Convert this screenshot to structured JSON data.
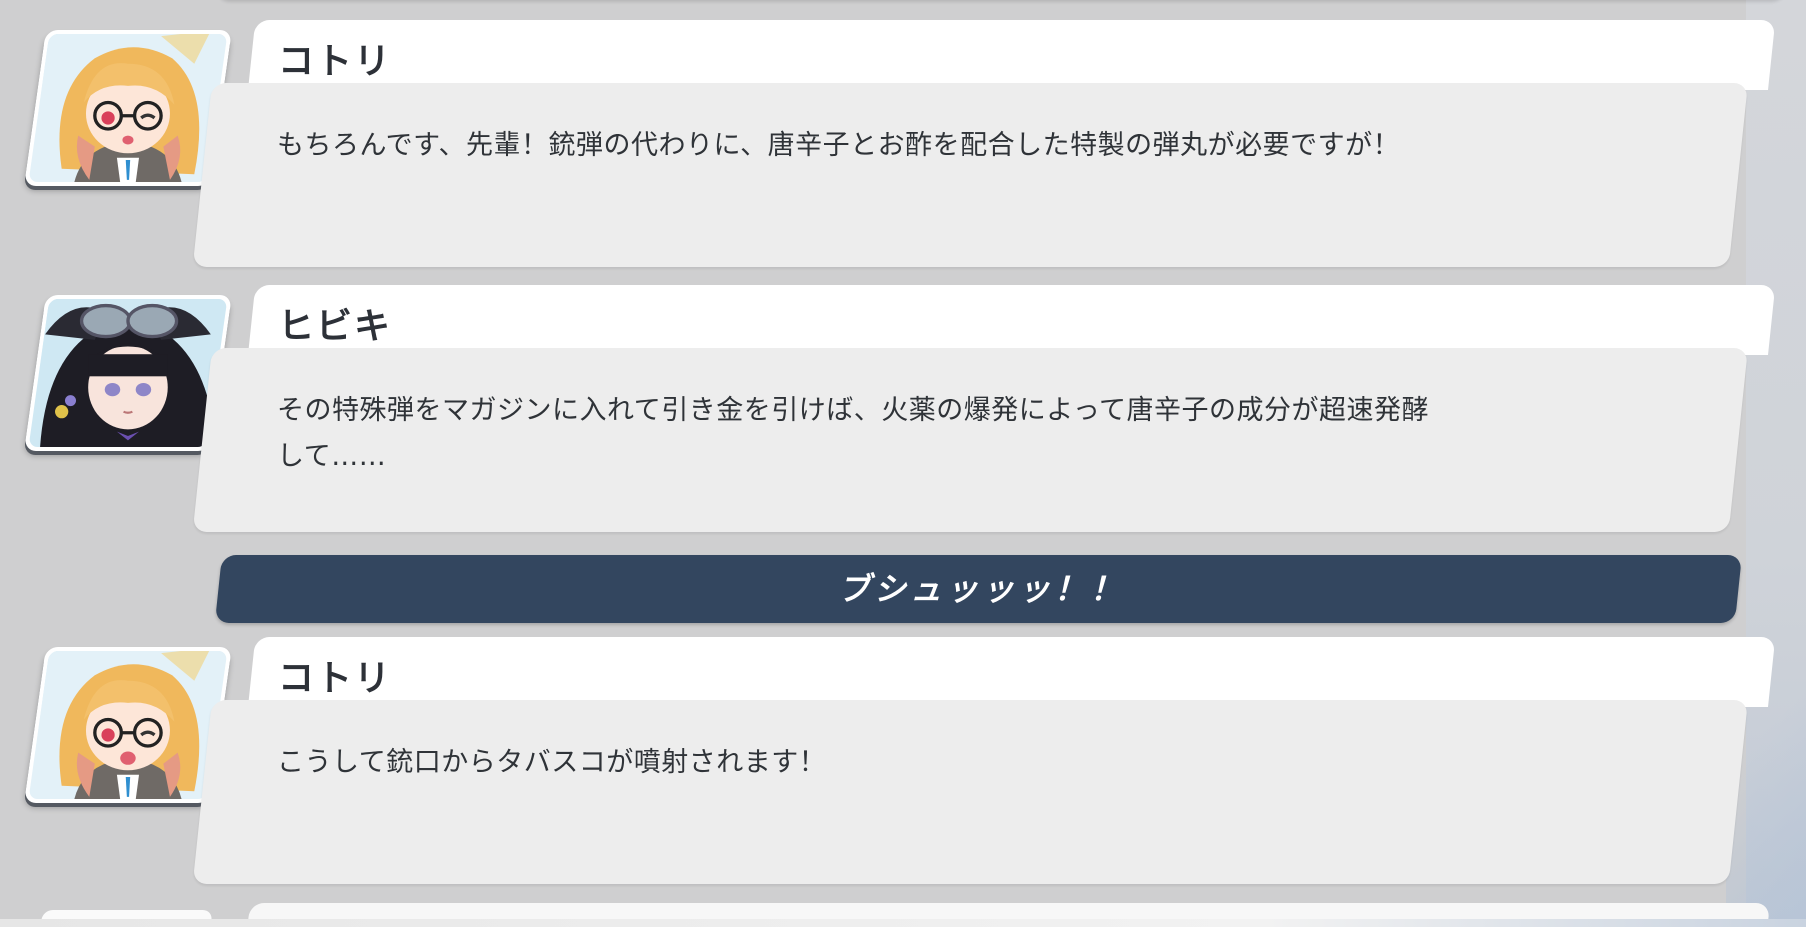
{
  "sound_effect": "ブシュッッッ！！",
  "entries": [
    {
      "speaker": "コトリ",
      "text": "もちろんです、先輩！銃弾の代わりに、唐辛子とお酢を配合した特製の弾丸が必要ですが！",
      "portrait": "kotori-portrait"
    },
    {
      "speaker": "ヒビキ",
      "text": "その特殊弾をマガジンに入れて引き金を引けば、火薬の爆発によって唐辛子の成分が超速発酵\nして……",
      "portrait": "hibiki-portrait"
    },
    {
      "speaker": "コトリ",
      "text": "こうして銃口からタバスコが噴射されます！",
      "portrait": "kotori-portrait"
    }
  ],
  "colors": {
    "background": "#cfcfd0",
    "bubble": "#ededed",
    "name_tab": "#ffffff",
    "sfx_banner": "#33465f",
    "text": "#2f3338"
  }
}
